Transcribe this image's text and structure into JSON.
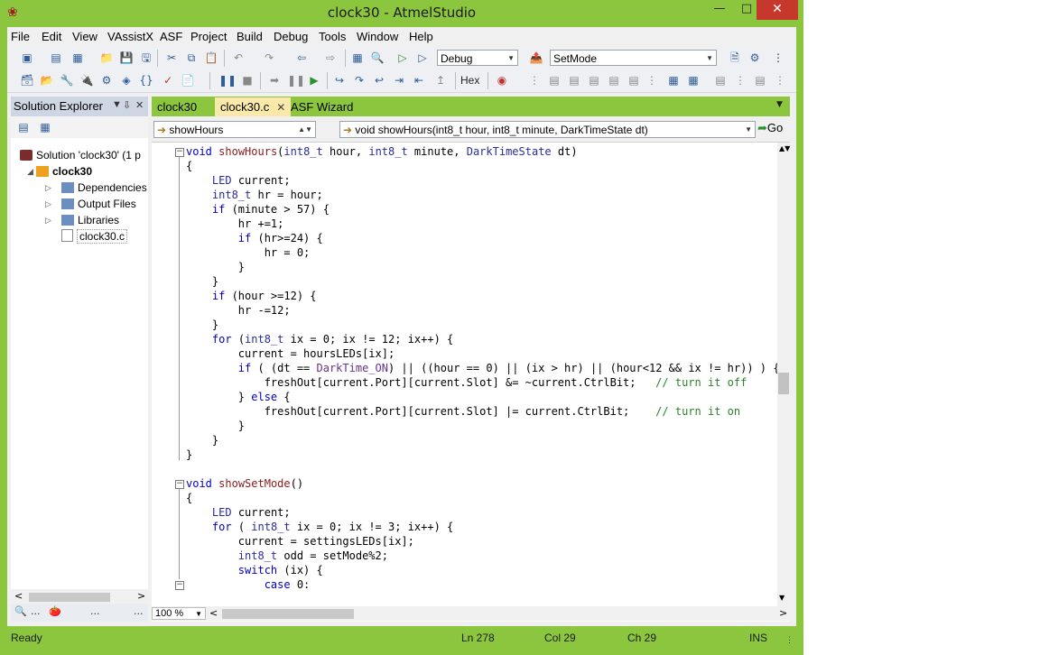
{
  "window": {
    "title": "clock30 - AtmelStudio",
    "controls": {
      "minimize": "—",
      "maximize": "□",
      "close": "✕"
    },
    "app_icon": "atmel-ladybug-icon",
    "frame_color": "#8cc63f"
  },
  "menubar": [
    "File",
    "Edit",
    "View",
    "VAssistX",
    "ASF",
    "Project",
    "Build",
    "Debug",
    "Tools",
    "Window",
    "Help"
  ],
  "toolbar1": {
    "configuration": "Debug",
    "mode_combo": "SetMode"
  },
  "toolbar2": {
    "hex_label": "Hex"
  },
  "solution_explorer": {
    "title": "Solution Explorer",
    "header_buttons": {
      "dropdown": "▼",
      "pin": "⇩",
      "close": "✕"
    },
    "tree": [
      {
        "label": "Solution 'clock30' (1 p",
        "expander": ""
      },
      {
        "label": "clock30",
        "expander": "◢"
      },
      {
        "label": "Dependencies",
        "expander": "▷"
      },
      {
        "label": "Output Files",
        "expander": "▷"
      },
      {
        "label": "Libraries",
        "expander": "▷"
      },
      {
        "label": "clock30.c",
        "expander": ""
      }
    ],
    "scroll_left": "<",
    "scroll_right": ">",
    "bottom_tabs": [
      "🔍",
      "...",
      "🍅",
      "...",
      "..."
    ]
  },
  "doc_tabs": [
    {
      "label": "clock30"
    },
    {
      "label": "clock30.c",
      "close": "✕",
      "active": true
    },
    {
      "label": "ASF Wizard"
    }
  ],
  "navbar": {
    "scope": "showHours",
    "member": "void showHours(int8_t hour, int8_t minute, DarkTimeState dt)",
    "go": "Go"
  },
  "code_lines": [
    "void showHours(int8_t hour, int8_t minute, DarkTimeState dt)",
    "{",
    "    LED current;",
    "    int8_t hr = hour;",
    "    if (minute > 57) {",
    "        hr +=1;",
    "        if (hr>=24) {",
    "            hr = 0;",
    "        }",
    "    }",
    "    if (hour >=12) {",
    "        hr -=12;",
    "    }",
    "    for (int8_t ix = 0; ix != 12; ix++) {",
    "        current = hoursLEDs[ix];",
    "        if ( (dt == DarkTime_ON) || ((hour == 0) || (ix > hr) || (hour<12 && ix != hr)) ) {",
    "            freshOut[current.Port][current.Slot] &= ~current.CtrlBit;   // turn it off",
    "        } else {",
    "            freshOut[current.Port][current.Slot] |= current.CtrlBit;    // turn it on",
    "        }",
    "    }",
    "}",
    "",
    "void showSetMode()",
    "{",
    "    LED current;",
    "    for ( int8_t ix = 0; ix != 3; ix++) {",
    "        current = settingsLEDs[ix];",
    "        int8_t odd = setMode%2;",
    "        switch (ix) {",
    "            case 0:"
  ],
  "fold_markers": {
    "collapse": "−"
  },
  "editor_footer": {
    "zoom": "100 %",
    "scroll_left": "<",
    "scroll_right": ">"
  },
  "statusbar": {
    "state": "Ready",
    "line": "Ln 278",
    "col": "Col 29",
    "ch": "Ch 29",
    "mode": "INS"
  }
}
